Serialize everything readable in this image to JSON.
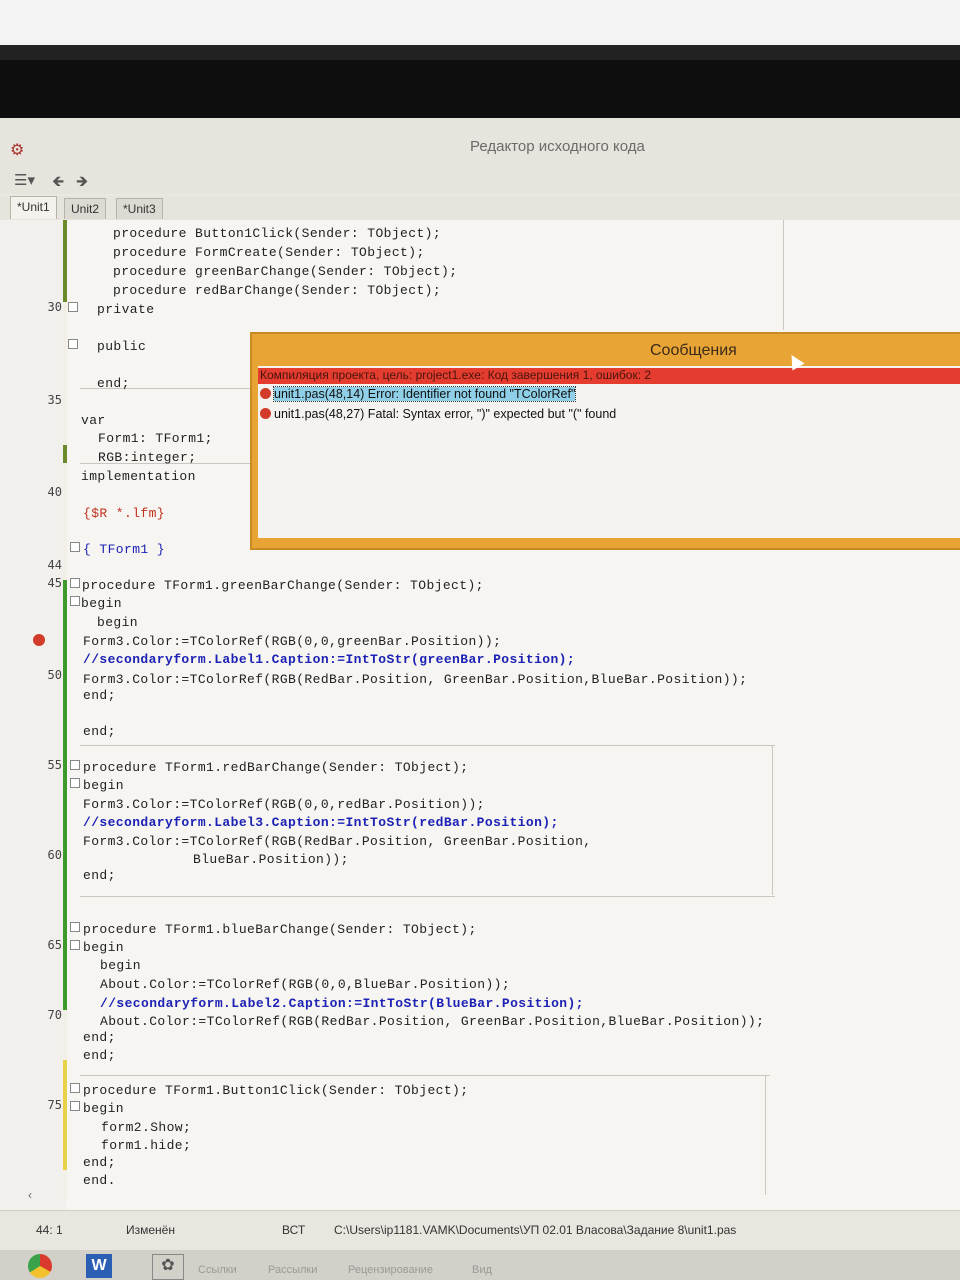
{
  "window": {
    "title": "Редактор исходного кода"
  },
  "tabs": [
    "*Unit1",
    "Unit2",
    "*Unit3"
  ],
  "gutter_numbers": [
    "30",
    "35",
    "40",
    "44",
    "45",
    "50",
    "55",
    "60",
    "65",
    "70",
    "75"
  ],
  "code": [
    "procedure Button1Click(Sender: TObject);",
    "procedure FormCreate(Sender: TObject);",
    "procedure greenBarChange(Sender: TObject);",
    "procedure redBarChange(Sender: TObject);",
    "private",
    "public",
    "end;",
    "var",
    "Form1: TForm1;",
    "RGB:integer;",
    "implementation",
    "{$R *.lfm}",
    "{ TForm1 }",
    "procedure TForm1.greenBarChange(Sender: TObject);",
    "begin",
    "begin",
    "Form3.Color:=TColorRef(RGB(0,0,greenBar.Position));",
    "//secondaryform.Label1.Caption:=IntToStr(greenBar.Position);",
    "Form3.Color:=TColorRef(RGB(RedBar.Position, GreenBar.Position,BlueBar.Position));",
    "end;",
    "end;",
    "procedure TForm1.redBarChange(Sender: TObject);",
    "begin",
    "Form3.Color:=TColorRef(RGB(0,0,redBar.Position));",
    "//secondaryform.Label3.Caption:=IntToStr(redBar.Position);",
    "Form3.Color:=TColorRef(RGB(RedBar.Position, GreenBar.Position,",
    "BlueBar.Position));",
    "end;",
    "procedure TForm1.blueBarChange(Sender: TObject);",
    "begin",
    "begin",
    "About.Color:=TColorRef(RGB(0,0,BlueBar.Position));",
    "//secondaryform.Label2.Caption:=IntToStr(BlueBar.Position);",
    "About.Color:=TColorRef(RGB(RedBar.Position, GreenBar.Position,BlueBar.Position));",
    "end;",
    "end;",
    "procedure TForm1.Button1Click(Sender: TObject);",
    "begin",
    "form2.Show;",
    "form1.hide;",
    "end;",
    "end."
  ],
  "messages": {
    "title": "Сообщения",
    "summary": "Компиляция проекта, цель: project1.exe: Код завершения 1, ошибок: 2",
    "items": [
      "unit1.pas(48,14) Error: Identifier not found \"TColorRef\"",
      "unit1.pas(48,27) Fatal: Syntax error, \")\" expected but \"(\" found"
    ]
  },
  "status": {
    "position": "44: 1",
    "modified": "Изменён",
    "mode": "ВСТ",
    "path": "C:\\Users\\ip1181.VAMK\\Documents\\УП 02.01 Власова\\Задание 8\\unit1.pas"
  },
  "taskbar": [
    "Ссылки",
    "Рассылки",
    "Рецензирование",
    "Вид"
  ],
  "colors": {
    "error": "#e43d2f",
    "comment": "#1d22b5",
    "messages_frame": "#e9a436"
  }
}
